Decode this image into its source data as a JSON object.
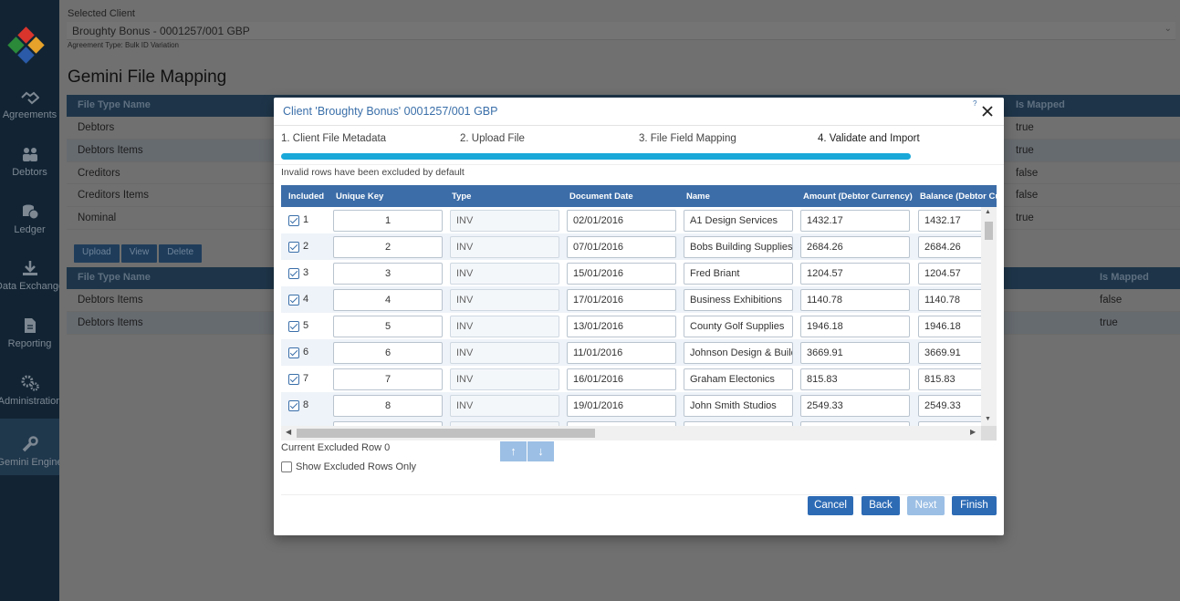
{
  "sidebar": {
    "items": [
      {
        "label": "Agreements",
        "icon": "handshake-icon"
      },
      {
        "label": "Debtors",
        "icon": "people-icon"
      },
      {
        "label": "Ledger",
        "icon": "coins-icon"
      },
      {
        "label": "Data Exchange",
        "icon": "download-icon"
      },
      {
        "label": "Reporting",
        "icon": "document-icon"
      },
      {
        "label": "Administration",
        "icon": "gears-icon"
      },
      {
        "label": "Gemini Engine",
        "icon": "wrench-icon",
        "active": true
      }
    ]
  },
  "client": {
    "label": "Selected Client",
    "value": "Broughty Bonus - 0001257/001 GBP",
    "agreement_type": "Agreement Type: Bulk ID Variation"
  },
  "page_title": "Gemini File Mapping",
  "top_table": {
    "headers": [
      "File Type Name",
      "Is Mapped"
    ],
    "rows": [
      {
        "name": "Debtors",
        "mapped": "true"
      },
      {
        "name": "Debtors Items",
        "mapped": "true"
      },
      {
        "name": "Creditors",
        "mapped": "false"
      },
      {
        "name": "Creditors Items",
        "mapped": "false"
      },
      {
        "name": "Nominal",
        "mapped": "true"
      }
    ]
  },
  "file_buttons": [
    "Upload",
    "View",
    "Delete"
  ],
  "bottom_table": {
    "headers": [
      "File Type Name",
      "Is Mapped"
    ],
    "rows": [
      {
        "name": "Debtors Items",
        "mapped": "false"
      },
      {
        "name": "Debtors Items",
        "mapped": "true"
      }
    ]
  },
  "modal": {
    "title": "Client 'Broughty Bonus' 0001257/001 GBP",
    "hint": "?",
    "steps": [
      "1. Client File Metadata",
      "2. Upload File",
      "3. File Field Mapping",
      "4. Validate and Import"
    ],
    "current_step": 4,
    "progress_fraction": 1.0,
    "invalid_note": "Invalid rows have been excluded by default",
    "columns": [
      "Included",
      "Unique Key",
      "Type",
      "Document Date",
      "Name",
      "Amount (Debtor Currency)",
      "Balance (Debtor Cur"
    ],
    "rows": [
      {
        "n": "1",
        "key": "1",
        "type": "INV",
        "date": "02/01/2016",
        "name": "A1 Design Services",
        "amount": "1432.17",
        "balance": "1432.17"
      },
      {
        "n": "2",
        "key": "2",
        "type": "INV",
        "date": "07/01/2016",
        "name": "Bobs Building Supplies",
        "amount": "2684.26",
        "balance": "2684.26"
      },
      {
        "n": "3",
        "key": "3",
        "type": "INV",
        "date": "15/01/2016",
        "name": "Fred Briant",
        "amount": "1204.57",
        "balance": "1204.57"
      },
      {
        "n": "4",
        "key": "4",
        "type": "INV",
        "date": "17/01/2016",
        "name": "Business Exhibitions",
        "amount": "1140.78",
        "balance": "1140.78"
      },
      {
        "n": "5",
        "key": "5",
        "type": "INV",
        "date": "13/01/2016",
        "name": "County Golf Supplies",
        "amount": "1946.18",
        "balance": "1946.18"
      },
      {
        "n": "6",
        "key": "6",
        "type": "INV",
        "date": "11/01/2016",
        "name": "Johnson Design & Building",
        "amount": "3669.91",
        "balance": "3669.91"
      },
      {
        "n": "7",
        "key": "7",
        "type": "INV",
        "date": "16/01/2016",
        "name": "Graham Electonics",
        "amount": "815.83",
        "balance": "815.83"
      },
      {
        "n": "8",
        "key": "8",
        "type": "INV",
        "date": "19/01/2016",
        "name": "John Smith Studios",
        "amount": "2549.33",
        "balance": "2549.33"
      }
    ],
    "excluded_label": "Current Excluded Row 0",
    "show_excluded_label": "Show Excluded Rows Only",
    "buttons": {
      "cancel": "Cancel",
      "back": "Back",
      "next": "Next",
      "finish": "Finish"
    }
  },
  "colors": {
    "sidebar": "#122434",
    "header_blue": "#3c6da8",
    "primary_button": "#2d6bb5",
    "progress": "#1aa8d9",
    "disabled_button": "#9cbfe5"
  }
}
